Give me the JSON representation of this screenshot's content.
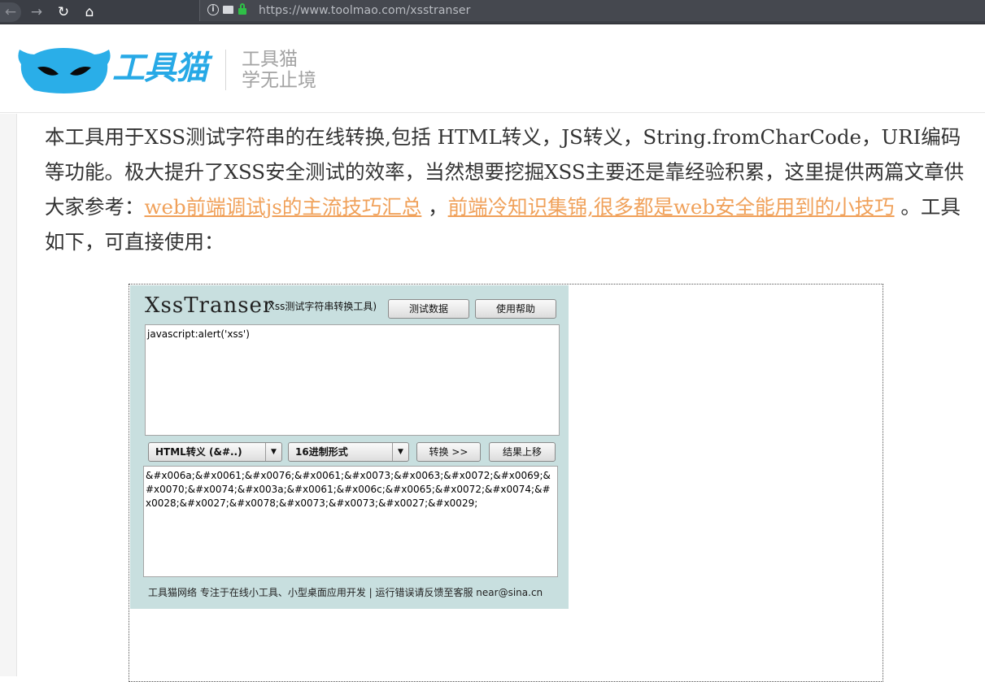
{
  "browser": {
    "url": "https://www.toolmao.com/xsstranser"
  },
  "header": {
    "logo_text": "工具猫",
    "slogan_line1": "工具猫",
    "slogan_line2": "学无止境"
  },
  "intro": {
    "text_1": "本工具用于XSS测试字符串的在线转换,包括 HTML转义，JS转义，String.fromCharCode，URI编码 等功能。极大提升了XSS安全测试的效率，当然想要挖掘XSS主要还是靠经验积累，这里提供两篇文章供大家参考：",
    "link_1": "web前端调试js的主流技巧汇总",
    "sep": " ，",
    "link_2": "前端冷知识集锦,很多都是web安全能用到的小技巧",
    "text_2": " 。工具如下，可直接使用："
  },
  "tool": {
    "title": "XssTranser",
    "subtitle": "(Xss测试字符串转换工具)",
    "btn_test": "测试数据",
    "btn_help": "使用帮助",
    "input_value": "javascript:alert('xss')",
    "mode_select": "HTML转义 (&#..)",
    "format_select": "16进制形式",
    "btn_convert": "转换 >>",
    "btn_move_up": "结果上移",
    "output_value": "&#x006a;&#x0061;&#x0076;&#x0061;&#x0073;&#x0063;&#x0072;&#x0069;&#x0070;&#x0074;&#x003a;&#x0061;&#x006c;&#x0065;&#x0072;&#x0074;&#x0028;&#x0027;&#x0078;&#x0073;&#x0073;&#x0027;&#x0029;",
    "footer": "工具猫网络    专注于在线小工具、小型桌面应用开发 | 运行错误请反馈至客服 near@sina.cn"
  }
}
